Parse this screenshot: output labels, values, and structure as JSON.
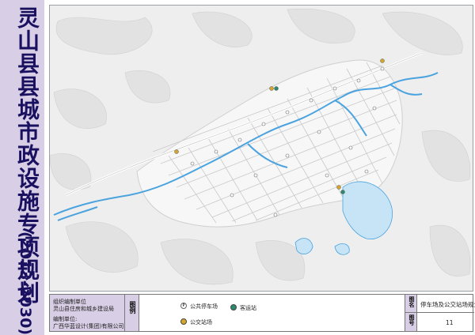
{
  "title": {
    "main": "灵山县县城市政设施专项规划",
    "years": "(2013-2030)"
  },
  "organization": {
    "compiler_label": "组织编制单位",
    "compiler": "灵山县住房和城乡建设局",
    "designer_label": "编制单位:",
    "designer": "广西华蓝设计(集团)有限公司"
  },
  "legend": {
    "label": "图例",
    "items": [
      {
        "symbol": "parking-lot-icon",
        "label": "公共停车场",
        "symbol_text": "P"
      },
      {
        "symbol": "passenger-station-icon",
        "label": "客运站"
      },
      {
        "symbol": "bus-station-icon",
        "label": "公交站场"
      }
    ]
  },
  "sheet": {
    "name_label": "图名",
    "name": "停车场及公交站场规划图",
    "number_label": "图号",
    "number": "11"
  },
  "colors": {
    "water": "#4aa3df",
    "road": "#ffffff",
    "background": "#f2f2f2",
    "hills": "#dcdcdc",
    "panel": "#d8cfe6",
    "title_text": "#1a1060"
  }
}
